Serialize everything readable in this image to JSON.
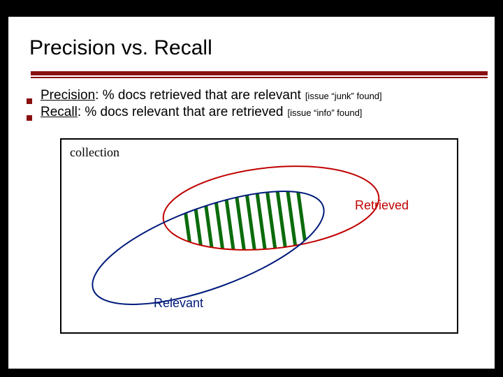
{
  "title": "Precision vs. Recall",
  "bullets": [
    {
      "term": "Precision",
      "rest": ": % docs retrieved that are relevant",
      "anno": "[issue “junk” found]"
    },
    {
      "term": "Recall",
      "rest": ": % docs relevant that are retrieved",
      "anno": "[issue “info” found]"
    }
  ],
  "figure": {
    "collection_label": "collection",
    "retrieved_label": "Retrieved",
    "relevant_label": "Relevant"
  },
  "colors": {
    "accent": "#8a0f0f",
    "retrieved": "#c00000",
    "relevant": "#001a7a",
    "hatch": "#0b6b0b"
  }
}
